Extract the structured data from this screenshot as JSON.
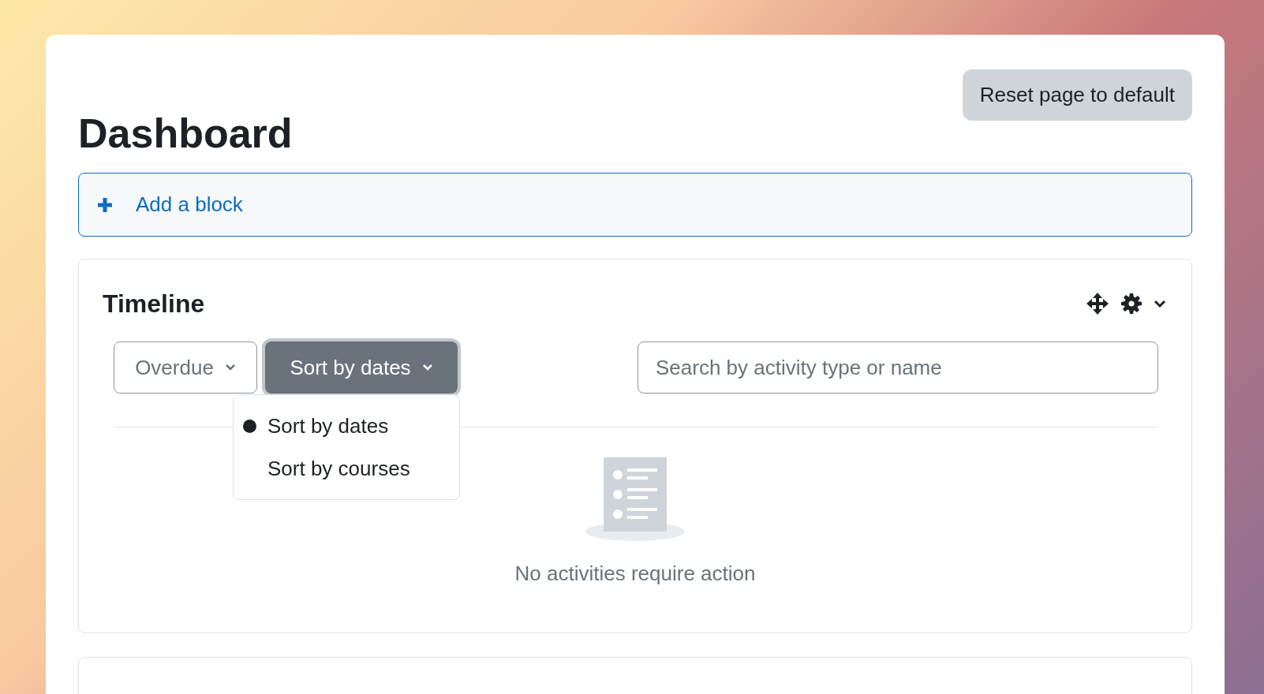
{
  "header": {
    "reset_button": "Reset page to default",
    "title": "Dashboard"
  },
  "add_block": {
    "label": "Add a block"
  },
  "timeline": {
    "title": "Timeline",
    "filter": {
      "label": "Overdue"
    },
    "sort": {
      "label": "Sort by dates",
      "expanded": true
    },
    "sort_options": [
      {
        "label": "Sort by dates",
        "selected": true
      },
      {
        "label": "Sort by courses",
        "selected": false
      }
    ],
    "search": {
      "placeholder": "Search by activity type or name"
    },
    "empty_message": "No activities require action"
  }
}
